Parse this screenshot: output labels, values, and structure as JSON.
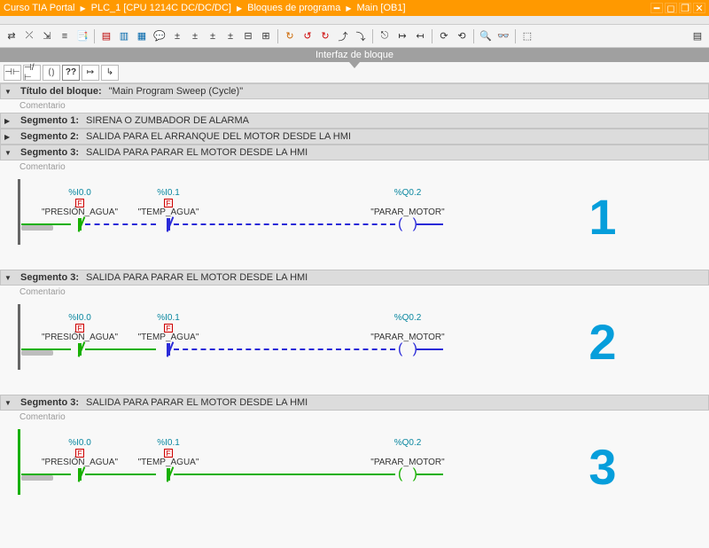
{
  "titlebar": {
    "crumbs": [
      "Curso TIA Portal",
      "PLC_1 [CPU 1214C DC/DC/DC]",
      "Bloques de programa",
      "Main [OB1]"
    ]
  },
  "iface_label": "Interfaz de bloque",
  "block_title_label": "Título del bloque:",
  "block_title_value": "\"Main Program Sweep (Cycle)\"",
  "comentario_label": "Comentario",
  "segments_top": [
    {
      "label": "Segmento 1:",
      "desc": "SIRENA O ZUMBADOR DE ALARMA",
      "expanded": false
    },
    {
      "label": "Segmento 2:",
      "desc": "SALIDA PARA EL ARRANQUE DEL MOTOR DESDE LA HMI",
      "expanded": false
    },
    {
      "label": "Segmento 3:",
      "desc": "SALIDA PARA PARAR EL MOTOR DESDE LA HMI",
      "expanded": true
    }
  ],
  "seg_repeat": {
    "label": "Segmento 3:",
    "desc": "SALIDA PARA PARAR EL MOTOR DESDE LA HMI"
  },
  "contacts": {
    "c1": {
      "addr": "%I0.0",
      "tag": "\"PRESIÓN_AGUA\""
    },
    "c2": {
      "addr": "%I0.1",
      "tag": "\"TEMP_AGUA\""
    },
    "coil": {
      "addr": "%Q0.2",
      "tag": "\"PARAR_MOTOR\""
    }
  },
  "numbers": {
    "n1": "1",
    "n2": "2",
    "n3": "3"
  }
}
